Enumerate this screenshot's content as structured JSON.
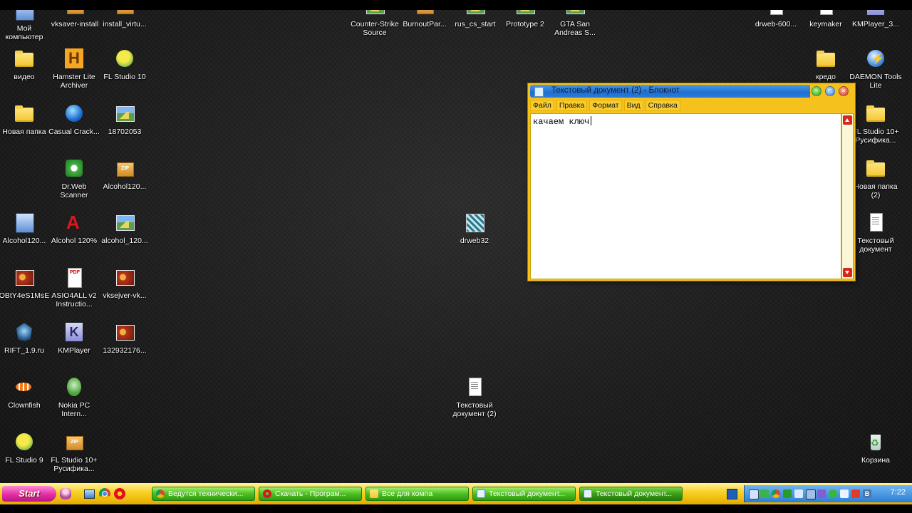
{
  "desktop_icons": [
    {
      "label": "Мой компьютер"
    },
    {
      "label": "vksaver-install"
    },
    {
      "label": "install_virtu..."
    },
    {
      "label": "Counter-Strike Source"
    },
    {
      "label": "BurnoutPar..."
    },
    {
      "label": "rus_cs_start"
    },
    {
      "label": "Prototype 2"
    },
    {
      "label": "GTA San Andreas S..."
    },
    {
      "label": "drweb-600..."
    },
    {
      "label": "keymaker"
    },
    {
      "label": "KMPlayer_3..."
    },
    {
      "label": "видео"
    },
    {
      "label": "Hamster Lite Archiver"
    },
    {
      "label": "FL Studio 10"
    },
    {
      "label": "кредо"
    },
    {
      "label": "DAEMON Tools Lite"
    },
    {
      "label": "Новая папка"
    },
    {
      "label": "Casual Crack..."
    },
    {
      "label": "18702053"
    },
    {
      "label": "FL Studio 10+ Русифика..."
    },
    {
      "label": "Dr.Web Scanner"
    },
    {
      "label": "Alcohol120..."
    },
    {
      "label": "Новая папка (2)"
    },
    {
      "label": "Alcohol120..."
    },
    {
      "label": "Alcohol 120%"
    },
    {
      "label": "alcohol_120..."
    },
    {
      "label": "drweb32"
    },
    {
      "label": "Текстовый документ"
    },
    {
      "label": "OBtY4eS1MsE"
    },
    {
      "label": "ASIO4ALL v2 Instructio..."
    },
    {
      "label": "vksejver-vk..."
    },
    {
      "label": "RIFT_1.9.ru"
    },
    {
      "label": "KMPlayer"
    },
    {
      "label": "132932176..."
    },
    {
      "label": "Clownfish"
    },
    {
      "label": "Nokia PC Intern..."
    },
    {
      "label": "Текстовый документ (2)"
    },
    {
      "label": "FL Studio 9"
    },
    {
      "label": "FL Studio 10+ Русифика..."
    },
    {
      "label": "Корзина"
    }
  ],
  "notepad": {
    "title": "Текстовый документ (2) - Блокнот",
    "menu": [
      "Файл",
      "Правка",
      "Формат",
      "Вид",
      "Справка"
    ],
    "content": "качаем ключ"
  },
  "taskbar": {
    "start_label": "Start",
    "tasks": [
      {
        "label": "Ведутся технически...",
        "icon": "chrome-icon"
      },
      {
        "label": "Скачать - Програм...",
        "icon": "opera-icon"
      },
      {
        "label": "Все для компа",
        "icon": "folder-icon"
      },
      {
        "label": "Текстовый документ...",
        "icon": "notepad-icon"
      },
      {
        "label": "Текстовый документ...",
        "icon": "notepad-icon"
      }
    ],
    "tray_letter": "B",
    "clock": "7:22"
  }
}
